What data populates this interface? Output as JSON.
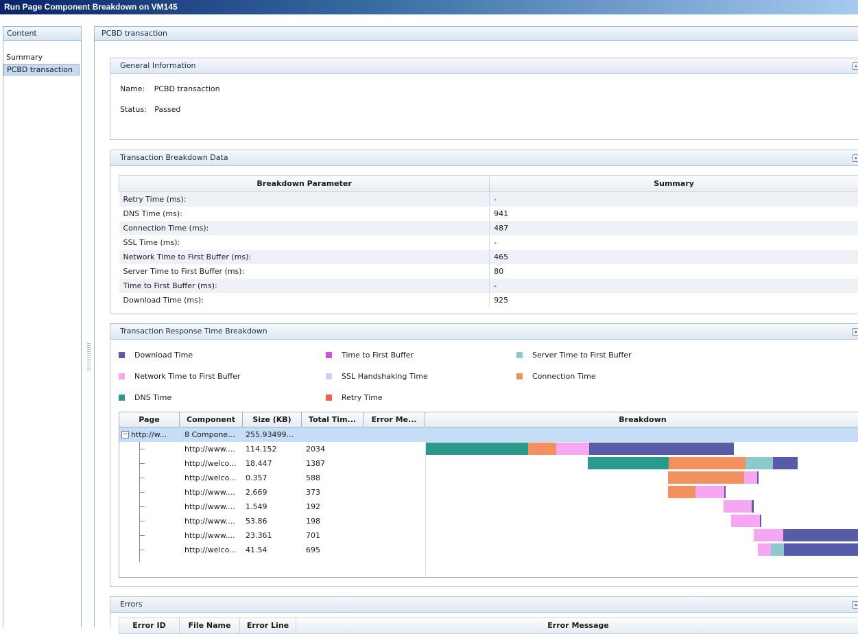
{
  "window": {
    "title": "Run Page Component Breakdown on VM145"
  },
  "nav": {
    "header": "Content",
    "items": [
      {
        "label": "Summary",
        "selected": false
      },
      {
        "label": "PCBD transaction",
        "selected": true
      }
    ]
  },
  "main": {
    "header": "PCBD transaction",
    "general": {
      "title": "General Information",
      "name_label": "Name:",
      "name_value": "PCBD transaction",
      "status_label": "Status:",
      "status_value": "Passed"
    },
    "breakdown_data": {
      "title": "Transaction Breakdown Data",
      "columns": [
        "Breakdown Parameter",
        "Summary"
      ],
      "rows": [
        {
          "param": "Retry Time (ms):",
          "value": "-"
        },
        {
          "param": "DNS Time (ms):",
          "value": "941"
        },
        {
          "param": "Connection Time (ms):",
          "value": "487"
        },
        {
          "param": "SSL Time (ms):",
          "value": "-"
        },
        {
          "param": "Network Time to First Buffer (ms):",
          "value": "465"
        },
        {
          "param": "Server Time to First Buffer (ms):",
          "value": "80"
        },
        {
          "param": "Time to First Buffer (ms):",
          "value": "-"
        },
        {
          "param": "Download Time (ms):",
          "value": "925"
        }
      ]
    },
    "response_breakdown": {
      "title": "Transaction Response Time Breakdown",
      "legend": [
        {
          "label": "Download Time",
          "color": "#585ca8"
        },
        {
          "label": "Time to First Buffer",
          "color": "#d94fd9"
        },
        {
          "label": "Server Time to First Buffer",
          "color": "#8cc9cc"
        },
        {
          "label": "Network Time to First Buffer",
          "color": "#f7a6f2"
        },
        {
          "label": "SSL Handshaking Time",
          "color": "#cfd0f0"
        },
        {
          "label": "Connection Time",
          "color": "#f29060"
        },
        {
          "label": "DNS Time",
          "color": "#2a9a8e"
        },
        {
          "label": "Retry Time",
          "color": "#f06050"
        }
      ],
      "columns": [
        "Page",
        "Component",
        "Size (KB)",
        "Total Tim...",
        "Error Me...",
        "Breakdown"
      ],
      "parent_row": {
        "page": "http://w...",
        "component": "8 Compone...",
        "size": "255.93499...",
        "total": "",
        "error": ""
      },
      "rows": [
        {
          "component": "http://www....",
          "size": "114.152",
          "total": "2034",
          "bars": [
            {
              "start": 0.0,
              "len": 0.236,
              "color": "#2a9a8e"
            },
            {
              "start": 0.236,
              "len": 0.064,
              "color": "#f29060"
            },
            {
              "start": 0.3,
              "len": 0.076,
              "color": "#f7a6f2"
            },
            {
              "start": 0.376,
              "len": 0.334,
              "color": "#585ca8"
            }
          ]
        },
        {
          "component": "http://welco...",
          "size": "18.447",
          "total": "1387",
          "bars": [
            {
              "start": 0.374,
              "len": 0.186,
              "color": "#2a9a8e"
            },
            {
              "start": 0.56,
              "len": 0.178,
              "color": "#f29060"
            },
            {
              "start": 0.738,
              "len": 0.062,
              "color": "#8cc9cc"
            },
            {
              "start": 0.8,
              "len": 0.058,
              "color": "#585ca8"
            }
          ]
        },
        {
          "component": "http://welco...",
          "size": "0.357",
          "total": "588",
          "bars": [
            {
              "start": 0.558,
              "len": 0.176,
              "color": "#f29060"
            },
            {
              "start": 0.734,
              "len": 0.03,
              "color": "#f7a6f2"
            },
            {
              "start": 0.764,
              "len": 0.004,
              "color": "#585ca8"
            }
          ]
        },
        {
          "component": "http://www....",
          "size": "2.669",
          "total": "373",
          "bars": [
            {
              "start": 0.558,
              "len": 0.064,
              "color": "#f29060"
            },
            {
              "start": 0.622,
              "len": 0.066,
              "color": "#f7a6f2"
            },
            {
              "start": 0.688,
              "len": 0.004,
              "color": "#585ca8"
            }
          ]
        },
        {
          "component": "http://www....",
          "size": "1.549",
          "total": "192",
          "bars": [
            {
              "start": 0.686,
              "len": 0.066,
              "color": "#f7a6f2"
            },
            {
              "start": 0.752,
              "len": 0.004,
              "color": "#585ca8"
            }
          ]
        },
        {
          "component": "http://www....",
          "size": "53.86",
          "total": "198",
          "bars": [
            {
              "start": 0.704,
              "len": 0.066,
              "color": "#f7a6f2"
            },
            {
              "start": 0.77,
              "len": 0.004,
              "color": "#585ca8"
            }
          ]
        },
        {
          "component": "http://www....",
          "size": "23.361",
          "total": "701",
          "bars": [
            {
              "start": 0.756,
              "len": 0.068,
              "color": "#f7a6f2"
            },
            {
              "start": 0.824,
              "len": 0.176,
              "color": "#585ca8"
            }
          ]
        },
        {
          "component": "http://welco...",
          "size": "41.54",
          "total": "695",
          "bars": [
            {
              "start": 0.766,
              "len": 0.03,
              "color": "#f7a6f2"
            },
            {
              "start": 0.796,
              "len": 0.03,
              "color": "#8cc9cc"
            },
            {
              "start": 0.826,
              "len": 0.174,
              "color": "#585ca8"
            }
          ]
        }
      ]
    },
    "errors": {
      "title": "Errors",
      "columns": [
        "Error ID",
        "File Name",
        "Error Line",
        "Error Message"
      ]
    }
  }
}
